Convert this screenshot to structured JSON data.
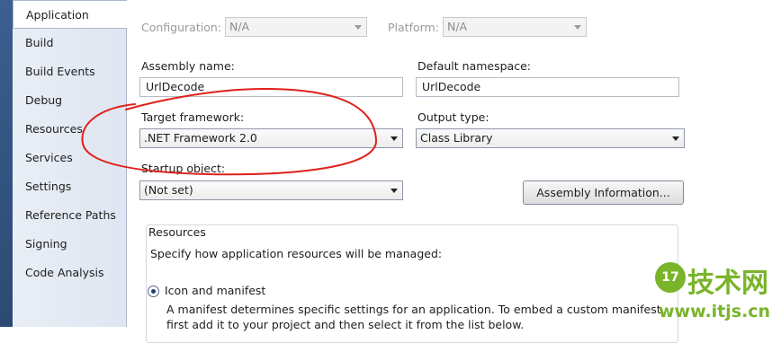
{
  "sidebar": {
    "items": [
      {
        "label": "Application",
        "active": true
      },
      {
        "label": "Build"
      },
      {
        "label": "Build Events"
      },
      {
        "label": "Debug"
      },
      {
        "label": "Resources"
      },
      {
        "label": "Services"
      },
      {
        "label": "Settings"
      },
      {
        "label": "Reference Paths"
      },
      {
        "label": "Signing"
      },
      {
        "label": "Code Analysis"
      }
    ]
  },
  "header": {
    "configuration_label": "Configuration:",
    "configuration_value": "N/A",
    "platform_label": "Platform:",
    "platform_value": "N/A"
  },
  "form": {
    "assembly_name_label": "Assembly name:",
    "assembly_name_value": "UrlDecode",
    "default_namespace_label": "Default namespace:",
    "default_namespace_value": "UrlDecode",
    "target_framework_label": "Target framework:",
    "target_framework_value": ".NET Framework 2.0",
    "output_type_label": "Output type:",
    "output_type_value": "Class Library",
    "startup_object_label": "Startup object:",
    "startup_object_value": "(Not set)",
    "assembly_info_button": "Assembly Information..."
  },
  "resources": {
    "title": "Resources",
    "description": "Specify how application resources will be managed:",
    "option_label": "Icon and manifest",
    "option_selected": true,
    "option_description": "A manifest determines specific settings for an application. To embed a custom manifest, first add it to your project and then select it from the list below."
  },
  "watermark": {
    "badge": "17",
    "name": "技术网",
    "url": "www.itjs.cn"
  },
  "colors": {
    "annotation": "#e0201b",
    "watermark": "#7ab42a"
  }
}
